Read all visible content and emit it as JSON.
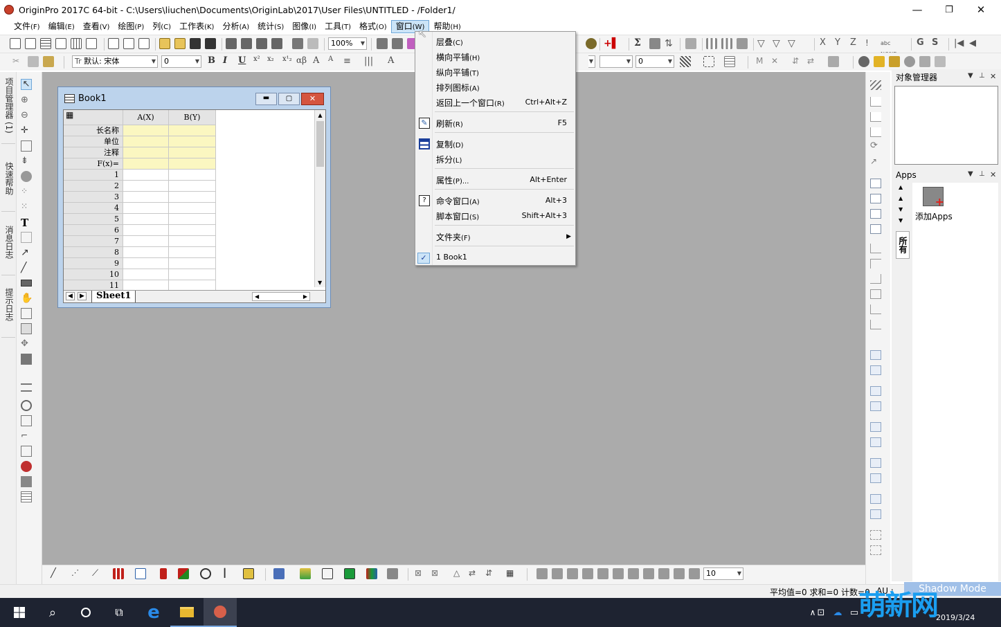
{
  "window": {
    "title": "OriginPro 2017C 64-bit - C:\\Users\\liuchen\\Documents\\OriginLab\\2017\\User Files\\UNTITLED - /Folder1/",
    "minimize": "—",
    "maximize": "❐",
    "close": "✕"
  },
  "menubar": [
    {
      "label": "文件",
      "acc": "(F)"
    },
    {
      "label": "编辑",
      "acc": "(E)"
    },
    {
      "label": "查看",
      "acc": "(V)"
    },
    {
      "label": "绘图",
      "acc": "(P)"
    },
    {
      "label": "列",
      "acc": "(C)"
    },
    {
      "label": "工作表",
      "acc": "(K)"
    },
    {
      "label": "分析",
      "acc": "(A)"
    },
    {
      "label": "统计",
      "acc": "(S)"
    },
    {
      "label": "图像",
      "acc": "(I)"
    },
    {
      "label": "工具",
      "acc": "(T)"
    },
    {
      "label": "格式",
      "acc": "(O)"
    },
    {
      "label": "窗口",
      "acc": "(W)"
    },
    {
      "label": "帮助",
      "acc": "(H)"
    }
  ],
  "toolbar": {
    "zoom": "100%",
    "font_name": "默认: 宋体",
    "font_size": "0",
    "bold": "B",
    "italic": "I",
    "underline": "U",
    "greek": "αβ",
    "sigma": "Σ",
    "xyz": [
      "X",
      "Y",
      "Z"
    ],
    "gs": [
      "G",
      "S"
    ],
    "right_combo": "0",
    "bottom_size": "10"
  },
  "left_tabs": [
    "项目管理器 (1)",
    "快速帮助",
    "消息日志",
    "提示日志"
  ],
  "book": {
    "title": "Book1",
    "columns": [
      "A(X)",
      "B(Y)"
    ],
    "row_headers": [
      "长名称",
      "单位",
      "注释",
      "F(x)="
    ],
    "rows": [
      "1",
      "2",
      "3",
      "4",
      "5",
      "6",
      "7",
      "8",
      "9",
      "10",
      "11"
    ],
    "sheet_tab": "Sheet1"
  },
  "window_menu": {
    "items": [
      {
        "label": "层叠",
        "acc": "(C)",
        "shortcut": ""
      },
      {
        "label": "横向平铺",
        "acc": "(H)",
        "shortcut": ""
      },
      {
        "label": "纵向平铺",
        "acc": "(T)",
        "shortcut": ""
      },
      {
        "label": "排列图标",
        "acc": "(A)",
        "shortcut": ""
      },
      {
        "label": "返回上一个窗口",
        "acc": "(R)",
        "shortcut": "Ctrl+Alt+Z"
      },
      {
        "label": "刷新",
        "acc": "(R)",
        "shortcut": "F5"
      },
      {
        "label": "复制",
        "acc": "(D)",
        "shortcut": ""
      },
      {
        "label": "拆分",
        "acc": "(L)",
        "shortcut": ""
      },
      {
        "label": "属性",
        "acc": "(P)...",
        "shortcut": "Alt+Enter"
      },
      {
        "label": "命令窗口",
        "acc": "(A)",
        "shortcut": "Alt+3"
      },
      {
        "label": "脚本窗口",
        "acc": "(S)",
        "shortcut": "Shift+Alt+3"
      },
      {
        "label": "文件夹",
        "acc": "(F)",
        "shortcut": "▶"
      },
      {
        "label": "1 Book1",
        "acc": "",
        "shortcut": ""
      }
    ]
  },
  "right_panel": {
    "object_manager": "对象管理器",
    "apps_title": "Apps",
    "add_apps": "添加Apps",
    "all_tab": "所有"
  },
  "statusbar": {
    "stats": "平均值=0 求和=0 计数=0",
    "au": "AU :",
    "shadow": "Shadow Mode"
  },
  "taskbar": {
    "datetime": "2019/3/24"
  },
  "watermark": "萌新网",
  "colors": {
    "workspace": "#ababab",
    "menu_highlight": "#cce4f7",
    "taskbar": "#1e2331",
    "label_rows": "#fbf7c1"
  }
}
